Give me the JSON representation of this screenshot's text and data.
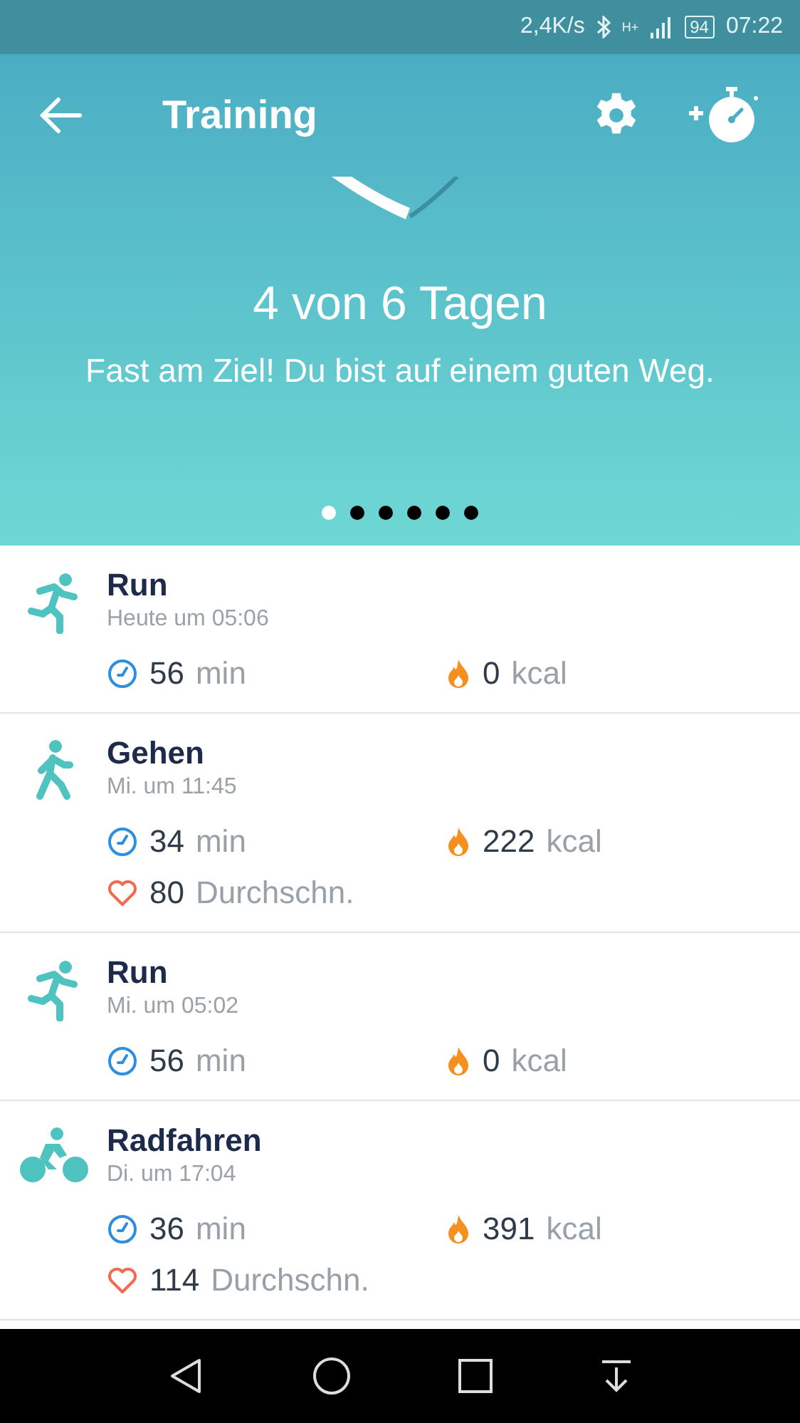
{
  "status_bar": {
    "speed": "2,4K/s",
    "network": "H+",
    "battery": "94",
    "time": "07:22"
  },
  "header": {
    "title": "Training"
  },
  "summary": {
    "headline": "4 von 6 Tagen",
    "message": "Fast am Ziel! Du bist auf einem guten Weg."
  },
  "pager": [
    {
      "selected": true
    },
    {
      "selected": false
    },
    {
      "selected": false
    },
    {
      "selected": false
    },
    {
      "selected": false
    },
    {
      "selected": false
    }
  ],
  "activities": [
    {
      "kind": "run",
      "name": "Run",
      "time": "Heute um 05:06",
      "duration": "56",
      "duration_unit": "min",
      "calories": "0",
      "calories_unit": "kcal"
    },
    {
      "kind": "walk",
      "name": "Gehen",
      "time": "Mi. um 11:45",
      "duration": "34",
      "duration_unit": "min",
      "calories": "222",
      "calories_unit": "kcal",
      "heart_rate": "80",
      "heart_unit": "Durchschn."
    },
    {
      "kind": "run",
      "name": "Run",
      "time": "Mi. um 05:02",
      "duration": "56",
      "duration_unit": "min",
      "calories": "0",
      "calories_unit": "kcal"
    },
    {
      "kind": "bike",
      "name": "Radfahren",
      "time": "Di. um 17:04",
      "duration": "36",
      "duration_unit": "min",
      "calories": "391",
      "calories_unit": "kcal",
      "heart_rate": "114",
      "heart_unit": "Durchschn."
    }
  ]
}
